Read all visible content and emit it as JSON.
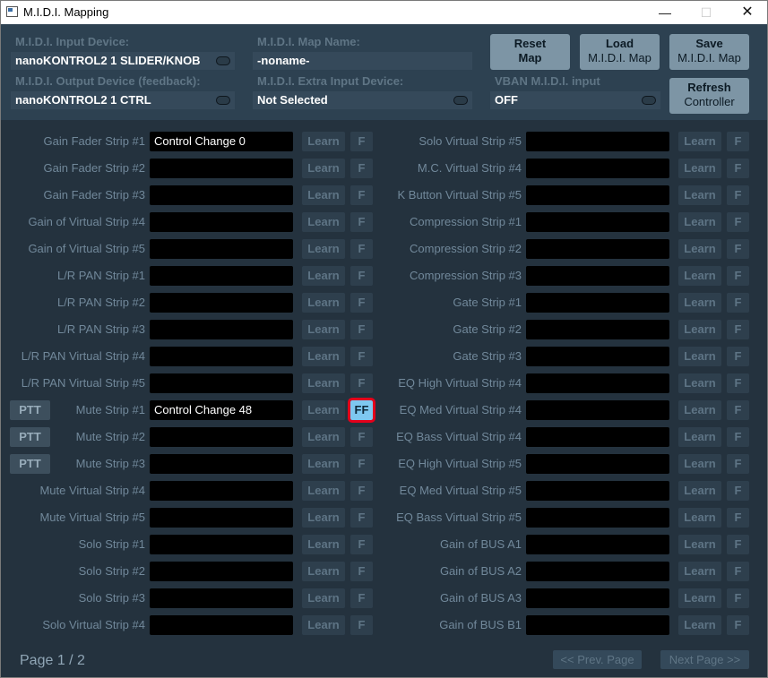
{
  "window": {
    "title": "M.I.D.I. Mapping",
    "minimize": "—",
    "maximize": "☐",
    "close": "✕"
  },
  "config": {
    "input_device_label": "M.I.D.I. Input Device:",
    "input_device_value": "nanoKONTROL2 1 SLIDER/KNOB",
    "output_device_label": "M.I.D.I. Output Device (feedback):",
    "output_device_value": "nanoKONTROL2 1 CTRL",
    "map_name_label": "M.I.D.I. Map Name:",
    "map_name_value": "-noname-",
    "extra_input_label": "M.I.D.I. Extra Input Device:",
    "extra_input_value": "Not Selected",
    "vban_label": "VBAN M.I.D.I. input",
    "vban_value": "OFF",
    "reset_line1": "Reset",
    "reset_line2": "Map",
    "load_line1": "Load",
    "load_line2": "M.I.D.I. Map",
    "save_line1": "Save",
    "save_line2": "M.I.D.I. Map",
    "refresh_line1": "Refresh",
    "refresh_line2": "Controller"
  },
  "left_rows": [
    {
      "label": "Gain Fader Strip #1",
      "value": "Control Change 0",
      "learn": "Learn",
      "f": "F",
      "ptt": ""
    },
    {
      "label": "Gain Fader Strip #2",
      "value": "",
      "learn": "Learn",
      "f": "F",
      "ptt": ""
    },
    {
      "label": "Gain Fader Strip #3",
      "value": "",
      "learn": "Learn",
      "f": "F",
      "ptt": ""
    },
    {
      "label": "Gain of Virtual Strip #4",
      "value": "",
      "learn": "Learn",
      "f": "F",
      "ptt": ""
    },
    {
      "label": "Gain of Virtual Strip #5",
      "value": "",
      "learn": "Learn",
      "f": "F",
      "ptt": ""
    },
    {
      "label": "L/R PAN Strip #1",
      "value": "",
      "learn": "Learn",
      "f": "F",
      "ptt": ""
    },
    {
      "label": "L/R PAN Strip #2",
      "value": "",
      "learn": "Learn",
      "f": "F",
      "ptt": ""
    },
    {
      "label": "L/R PAN Strip #3",
      "value": "",
      "learn": "Learn",
      "f": "F",
      "ptt": ""
    },
    {
      "label": "L/R PAN Virtual Strip #4",
      "value": "",
      "learn": "Learn",
      "f": "F",
      "ptt": ""
    },
    {
      "label": "L/R PAN Virtual Strip #5",
      "value": "",
      "learn": "Learn",
      "f": "F",
      "ptt": ""
    },
    {
      "label": "Mute Strip #1",
      "value": "Control Change 48",
      "learn": "Learn",
      "f": "FF",
      "ptt": "PTT"
    },
    {
      "label": "Mute Strip #2",
      "value": "",
      "learn": "Learn",
      "f": "F",
      "ptt": "PTT"
    },
    {
      "label": "Mute Strip #3",
      "value": "",
      "learn": "Learn",
      "f": "F",
      "ptt": "PTT"
    },
    {
      "label": "Mute Virtual Strip #4",
      "value": "",
      "learn": "Learn",
      "f": "F",
      "ptt": ""
    },
    {
      "label": "Mute Virtual Strip #5",
      "value": "",
      "learn": "Learn",
      "f": "F",
      "ptt": ""
    },
    {
      "label": "Solo Strip #1",
      "value": "",
      "learn": "Learn",
      "f": "F",
      "ptt": ""
    },
    {
      "label": "Solo Strip #2",
      "value": "",
      "learn": "Learn",
      "f": "F",
      "ptt": ""
    },
    {
      "label": "Solo Strip #3",
      "value": "",
      "learn": "Learn",
      "f": "F",
      "ptt": ""
    },
    {
      "label": "Solo Virtual Strip #4",
      "value": "",
      "learn": "Learn",
      "f": "F",
      "ptt": ""
    }
  ],
  "right_rows": [
    {
      "label": "Solo Virtual Strip #5",
      "value": "",
      "learn": "Learn",
      "f": "F"
    },
    {
      "label": "M.C. Virtual Strip #4",
      "value": "",
      "learn": "Learn",
      "f": "F"
    },
    {
      "label": "K Button Virtual Strip #5",
      "value": "",
      "learn": "Learn",
      "f": "F"
    },
    {
      "label": "Compression Strip #1",
      "value": "",
      "learn": "Learn",
      "f": "F"
    },
    {
      "label": "Compression Strip #2",
      "value": "",
      "learn": "Learn",
      "f": "F"
    },
    {
      "label": "Compression Strip #3",
      "value": "",
      "learn": "Learn",
      "f": "F"
    },
    {
      "label": "Gate Strip #1",
      "value": "",
      "learn": "Learn",
      "f": "F"
    },
    {
      "label": "Gate Strip #2",
      "value": "",
      "learn": "Learn",
      "f": "F"
    },
    {
      "label": "Gate Strip #3",
      "value": "",
      "learn": "Learn",
      "f": "F"
    },
    {
      "label": "EQ High Virtual Strip #4",
      "value": "",
      "learn": "Learn",
      "f": "F"
    },
    {
      "label": "EQ Med Virtual Strip #4",
      "value": "",
      "learn": "Learn",
      "f": "F"
    },
    {
      "label": "EQ Bass Virtual Strip #4",
      "value": "",
      "learn": "Learn",
      "f": "F"
    },
    {
      "label": "EQ High Virtual Strip #5",
      "value": "",
      "learn": "Learn",
      "f": "F"
    },
    {
      "label": "EQ Med Virtual Strip #5",
      "value": "",
      "learn": "Learn",
      "f": "F"
    },
    {
      "label": "EQ Bass Virtual Strip #5",
      "value": "",
      "learn": "Learn",
      "f": "F"
    },
    {
      "label": "Gain of BUS A1",
      "value": "",
      "learn": "Learn",
      "f": "F"
    },
    {
      "label": "Gain of BUS A2",
      "value": "",
      "learn": "Learn",
      "f": "F"
    },
    {
      "label": "Gain of BUS A3",
      "value": "",
      "learn": "Learn",
      "f": "F"
    },
    {
      "label": "Gain of BUS B1",
      "value": "",
      "learn": "Learn",
      "f": "F"
    }
  ],
  "footer": {
    "page_label": "Page 1 / 2",
    "prev_label": "<< Prev. Page",
    "next_label": "Next Page >>"
  },
  "colors": {
    "panel_bg": "#24323e",
    "config_bg": "#2d4151",
    "field_bg": "#000000",
    "accent_active_f": "#7ec8f0",
    "highlight_outline": "#e3001b"
  }
}
